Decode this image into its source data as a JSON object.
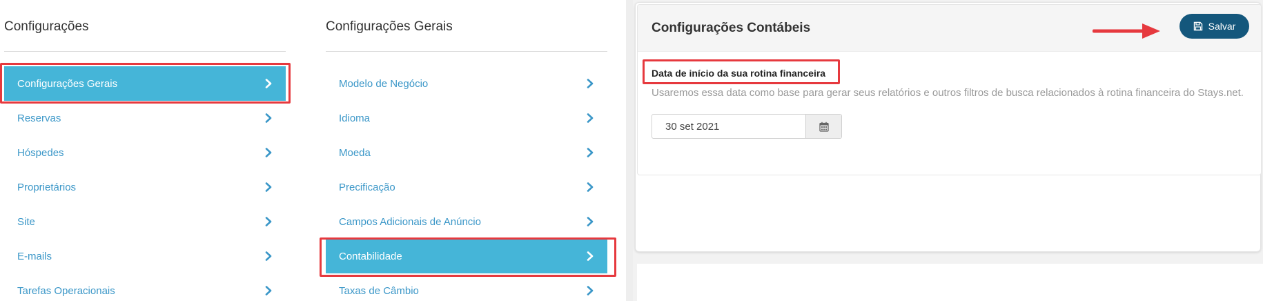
{
  "col1": {
    "title": "Configurações",
    "items": [
      {
        "label": "Configurações Gerais",
        "active": true
      },
      {
        "label": "Reservas"
      },
      {
        "label": "Hóspedes"
      },
      {
        "label": "Proprietários"
      },
      {
        "label": "Site"
      },
      {
        "label": "E-mails"
      },
      {
        "label": "Tarefas Operacionais"
      }
    ]
  },
  "col2": {
    "title": "Configurações Gerais",
    "items": [
      {
        "label": "Modelo de Negócio"
      },
      {
        "label": "Idioma"
      },
      {
        "label": "Moeda"
      },
      {
        "label": "Precificação"
      },
      {
        "label": "Campos Adicionais de Anúncio"
      },
      {
        "label": "Contabilidade",
        "active": true
      },
      {
        "label": "Taxas de Câmbio"
      }
    ]
  },
  "panel": {
    "title": "Configurações Contábeis",
    "save_label": "Salvar",
    "field_label": "Data de início da sua rotina financeira",
    "field_help": "Usaremos essa data como base para gerar seus relatórios e outros filtros de busca relacionados à rotina financeira do Stays.net.",
    "date_value": "30 set 2021"
  },
  "colors": {
    "active_bg": "#45b5d8",
    "link": "#3b97c8",
    "save_bg": "#14577c",
    "highlight": "#e6393e"
  },
  "icons": {
    "chevron": "chevron-right-icon",
    "save": "floppy-disk-icon",
    "calendar": "calendar-icon",
    "arrow": "red-arrow-annotation"
  }
}
